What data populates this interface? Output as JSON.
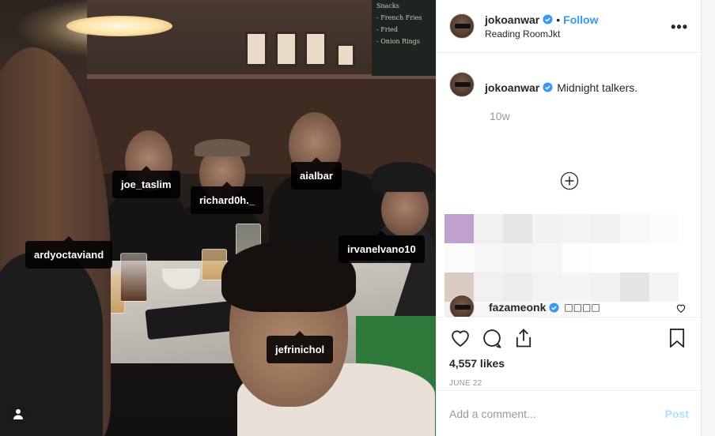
{
  "photo": {
    "tags": [
      {
        "label": "joe_taslim"
      },
      {
        "label": "richard0h._"
      },
      {
        "label": "aialbar"
      },
      {
        "label": "ardyoctaviand"
      },
      {
        "label": "irvanelvano10"
      },
      {
        "label": "jefrinichol"
      }
    ],
    "chalkboard_lines": [
      "Snacks",
      "- French Fries",
      "- Fried",
      "- Onion Rings"
    ],
    "user_toggle_icon": "user-silhouette-icon"
  },
  "header": {
    "username": "jokoanwar",
    "separator": "•",
    "follow_label": "Follow",
    "location": "Reading RoomJkt",
    "more_icon": "more-options-icon"
  },
  "caption": {
    "username": "jokoanwar",
    "text": "Midnight talkers.",
    "time_ago": "10w"
  },
  "comment": {
    "username": "fazameonk",
    "text": "□□□□"
  },
  "actions": {
    "likes": "4,557 likes",
    "date": "JUNE 22"
  },
  "add_comment": {
    "placeholder": "Add a comment...",
    "post_label": "Post"
  },
  "colors": {
    "link_blue": "#3897f0",
    "verified_blue": "#3897f0",
    "post_disabled": "#b2dffc"
  }
}
